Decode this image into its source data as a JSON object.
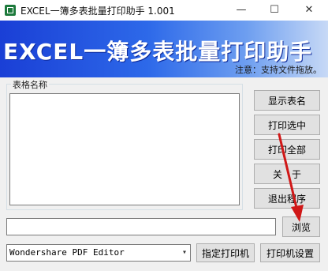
{
  "window": {
    "title": "EXCEL一簿多表批量打印助手  1.001",
    "minimize_glyph": "—",
    "maximize_glyph": "☐",
    "close_glyph": "✕"
  },
  "banner": {
    "title": "EXCEL一簿多表批量打印助手",
    "note": "注意：支持文件拖放。"
  },
  "sheet_list": {
    "group_label": "表格名称",
    "items": []
  },
  "buttons": {
    "show_sheets": "显示表名",
    "print_selected": "打印选中",
    "print_all": "打印全部",
    "about": "关　于",
    "exit": "退出程序",
    "browse": "浏览",
    "set_printer": "指定打印机",
    "printer_settings": "打印机设置"
  },
  "file_path": {
    "value": ""
  },
  "printer": {
    "selected": "Wondershare PDF Editor",
    "dropdown_glyph": "▾"
  },
  "colors": {
    "banner_start": "#1a3fd6",
    "banner_end": "#c7d9f6",
    "annotation_arrow": "#d01818"
  }
}
